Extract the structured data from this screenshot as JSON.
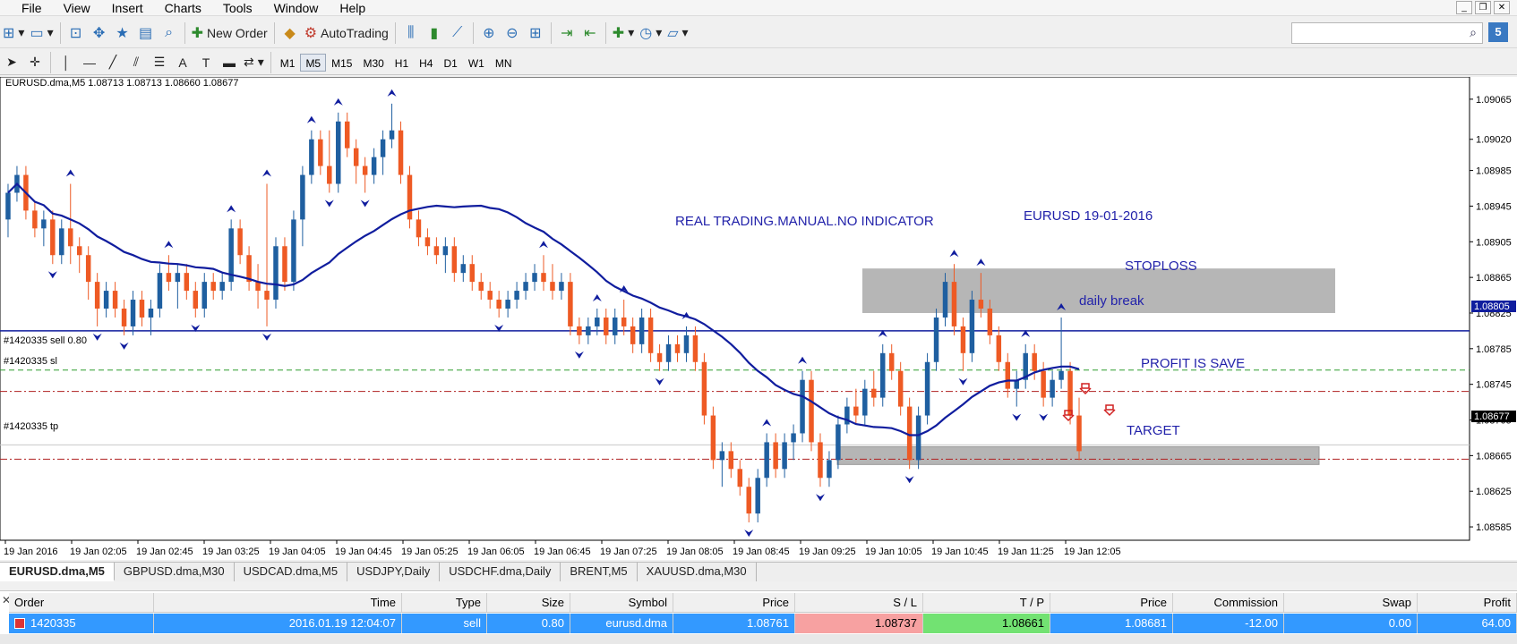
{
  "menu": [
    "File",
    "View",
    "Insert",
    "Charts",
    "Tools",
    "Window",
    "Help"
  ],
  "toolbar": {
    "new_order": "New Order",
    "autotrading": "AutoTrading",
    "timeframes": [
      "M1",
      "M5",
      "M15",
      "M30",
      "H1",
      "H4",
      "D1",
      "W1",
      "MN"
    ],
    "active_timeframe": "M5",
    "help_badge": "5"
  },
  "chart": {
    "info": "EURUSD.dma,M5  1.08713 1.08713 1.08660 1.08677",
    "title_note": "REAL TRADING.MANUAL.NO INDICATOR",
    "date_note": "EURUSD 19-01-2016",
    "stoploss_label": "STOPLOSS",
    "daily_break_label": "daily break",
    "profit_label": "PROFIT IS SAVE",
    "target_label": "TARGET",
    "order_lines": {
      "sell": "#1420335 sell 0.80",
      "sl": "#1420335 sl",
      "tp": "#1420335 tp"
    },
    "price_ticks": [
      "1.09065",
      "1.09020",
      "1.08985",
      "1.08945",
      "1.08905",
      "1.08865",
      "1.08825",
      "1.08785",
      "1.08745",
      "1.08705",
      "1.08665",
      "1.08625",
      "1.08585"
    ],
    "price_badges": {
      "daily_break": "1.08805",
      "current": "1.08677"
    },
    "time_ticks": [
      "19 Jan 2016",
      "19 Jan 02:05",
      "19 Jan 02:45",
      "19 Jan 03:25",
      "19 Jan 04:05",
      "19 Jan 04:45",
      "19 Jan 05:25",
      "19 Jan 06:05",
      "19 Jan 06:45",
      "19 Jan 07:25",
      "19 Jan 08:05",
      "19 Jan 08:45",
      "19 Jan 09:25",
      "19 Jan 10:05",
      "19 Jan 10:45",
      "19 Jan 11:25",
      "19 Jan 12:05"
    ],
    "colors": {
      "bull": "#1f5fa0",
      "bear": "#ee5a24",
      "ma": "#101d9e",
      "label": "#2222aa"
    }
  },
  "chart_data": {
    "type": "candlestick",
    "symbol": "EURUSD.dma",
    "timeframe": "M5",
    "ylim": [
      1.0857,
      1.0909
    ],
    "levels": {
      "daily_break": 1.08805,
      "sell_entry": 1.08761,
      "stop_loss": 1.08737,
      "take_profit": 1.08661,
      "current_bid": 1.08677
    },
    "zones": {
      "stoploss": [
        1.08825,
        1.08875
      ],
      "target": [
        1.08655,
        1.08675
      ]
    },
    "candles_ohlc": [
      [
        1.0893,
        1.0897,
        1.0891,
        1.0896
      ],
      [
        1.0896,
        1.0899,
        1.0895,
        1.0898
      ],
      [
        1.0898,
        1.0899,
        1.0893,
        1.0894
      ],
      [
        1.0894,
        1.0895,
        1.0891,
        1.0892
      ],
      [
        1.0892,
        1.0894,
        1.089,
        1.0893
      ],
      [
        1.0893,
        1.0894,
        1.0888,
        1.0889
      ],
      [
        1.0889,
        1.0893,
        1.0888,
        1.0892
      ],
      [
        1.0892,
        1.0897,
        1.0888,
        1.089
      ],
      [
        1.089,
        1.0891,
        1.0887,
        1.0889
      ],
      [
        1.0889,
        1.089,
        1.0884,
        1.0886
      ],
      [
        1.0886,
        1.0887,
        1.0881,
        1.0883
      ],
      [
        1.0883,
        1.0886,
        1.0882,
        1.0885
      ],
      [
        1.0885,
        1.0886,
        1.0882,
        1.0883
      ],
      [
        1.0883,
        1.0884,
        1.088,
        1.0881
      ],
      [
        1.0881,
        1.0885,
        1.088,
        1.0884
      ],
      [
        1.0884,
        1.0885,
        1.0881,
        1.0882
      ],
      [
        1.0882,
        1.0884,
        1.088,
        1.0883
      ],
      [
        1.0883,
        1.0888,
        1.0882,
        1.0887
      ],
      [
        1.0887,
        1.0889,
        1.0885,
        1.0886
      ],
      [
        1.0886,
        1.0888,
        1.0883,
        1.0887
      ],
      [
        1.0887,
        1.0888,
        1.0884,
        1.0885
      ],
      [
        1.0885,
        1.0886,
        1.0882,
        1.0883
      ],
      [
        1.0883,
        1.0887,
        1.0882,
        1.0886
      ],
      [
        1.0886,
        1.0887,
        1.0884,
        1.0885
      ],
      [
        1.0885,
        1.0887,
        1.0884,
        1.0886
      ],
      [
        1.0886,
        1.0893,
        1.0885,
        1.0892
      ],
      [
        1.0892,
        1.0893,
        1.0888,
        1.0889
      ],
      [
        1.0889,
        1.089,
        1.0885,
        1.0886
      ],
      [
        1.0886,
        1.0888,
        1.0883,
        1.0885
      ],
      [
        1.0885,
        1.0897,
        1.0881,
        1.0884
      ],
      [
        1.0884,
        1.0891,
        1.0883,
        1.089
      ],
      [
        1.089,
        1.0891,
        1.0885,
        1.0886
      ],
      [
        1.0886,
        1.0894,
        1.0885,
        1.0893
      ],
      [
        1.0893,
        1.0899,
        1.089,
        1.0898
      ],
      [
        1.0898,
        1.0903,
        1.0897,
        1.0902
      ],
      [
        1.0902,
        1.0903,
        1.0898,
        1.0899
      ],
      [
        1.0899,
        1.0903,
        1.0896,
        1.0897
      ],
      [
        1.0897,
        1.0905,
        1.0896,
        1.0904
      ],
      [
        1.0904,
        1.0905,
        1.09,
        1.0901
      ],
      [
        1.0901,
        1.0902,
        1.0897,
        1.0899
      ],
      [
        1.0899,
        1.09,
        1.0896,
        1.0898
      ],
      [
        1.0898,
        1.0901,
        1.0897,
        1.09
      ],
      [
        1.09,
        1.0903,
        1.0898,
        1.0902
      ],
      [
        1.0902,
        1.0906,
        1.0901,
        1.0903
      ],
      [
        1.0903,
        1.0904,
        1.0897,
        1.0898
      ],
      [
        1.0898,
        1.0899,
        1.0892,
        1.0893
      ],
      [
        1.0893,
        1.0894,
        1.089,
        1.0891
      ],
      [
        1.0891,
        1.0892,
        1.0889,
        1.089
      ],
      [
        1.089,
        1.0891,
        1.0888,
        1.0889
      ],
      [
        1.0889,
        1.0891,
        1.0887,
        1.089
      ],
      [
        1.089,
        1.0891,
        1.0886,
        1.0887
      ],
      [
        1.0887,
        1.0889,
        1.0886,
        1.0888
      ],
      [
        1.0888,
        1.0889,
        1.0885,
        1.0886
      ],
      [
        1.0886,
        1.0887,
        1.0884,
        1.0885
      ],
      [
        1.0885,
        1.0886,
        1.0883,
        1.0884
      ],
      [
        1.0884,
        1.0885,
        1.0882,
        1.0883
      ],
      [
        1.0883,
        1.0885,
        1.0882,
        1.0884
      ],
      [
        1.0884,
        1.0886,
        1.0883,
        1.0885
      ],
      [
        1.0885,
        1.0887,
        1.0884,
        1.0886
      ],
      [
        1.0886,
        1.0888,
        1.0885,
        1.0887
      ],
      [
        1.0887,
        1.0889,
        1.0885,
        1.0886
      ],
      [
        1.0886,
        1.0888,
        1.0884,
        1.0885
      ],
      [
        1.0885,
        1.0887,
        1.0884,
        1.0886
      ],
      [
        1.0886,
        1.0887,
        1.088,
        1.0881
      ],
      [
        1.0881,
        1.0882,
        1.0879,
        1.088
      ],
      [
        1.088,
        1.0882,
        1.0879,
        1.0881
      ],
      [
        1.0881,
        1.0883,
        1.088,
        1.0882
      ],
      [
        1.0882,
        1.0883,
        1.0879,
        1.088
      ],
      [
        1.088,
        1.0883,
        1.0879,
        1.0882
      ],
      [
        1.0882,
        1.0884,
        1.088,
        1.0881
      ],
      [
        1.0881,
        1.0882,
        1.0878,
        1.0879
      ],
      [
        1.0879,
        1.0883,
        1.0878,
        1.0882
      ],
      [
        1.0882,
        1.0883,
        1.0877,
        1.0878
      ],
      [
        1.0878,
        1.0879,
        1.0876,
        1.0877
      ],
      [
        1.0877,
        1.088,
        1.0876,
        1.0879
      ],
      [
        1.0879,
        1.088,
        1.0877,
        1.0878
      ],
      [
        1.0878,
        1.0881,
        1.0877,
        1.088
      ],
      [
        1.088,
        1.0881,
        1.0876,
        1.0877
      ],
      [
        1.0877,
        1.0878,
        1.087,
        1.0871
      ],
      [
        1.0871,
        1.0872,
        1.0865,
        1.0866
      ],
      [
        1.0866,
        1.0868,
        1.0863,
        1.0867
      ],
      [
        1.0867,
        1.0868,
        1.0864,
        1.0865
      ],
      [
        1.0865,
        1.0866,
        1.0862,
        1.0863
      ],
      [
        1.0863,
        1.0864,
        1.0859,
        1.086
      ],
      [
        1.086,
        1.0865,
        1.0859,
        1.0864
      ],
      [
        1.0864,
        1.0869,
        1.0863,
        1.0868
      ],
      [
        1.0868,
        1.0869,
        1.0864,
        1.0865
      ],
      [
        1.0865,
        1.0869,
        1.0864,
        1.0868
      ],
      [
        1.0868,
        1.087,
        1.0866,
        1.0869
      ],
      [
        1.0869,
        1.0876,
        1.0868,
        1.0875
      ],
      [
        1.0875,
        1.0876,
        1.0867,
        1.0868
      ],
      [
        1.0868,
        1.0869,
        1.0863,
        1.0864
      ],
      [
        1.0864,
        1.0867,
        1.0863,
        1.0866
      ],
      [
        1.0866,
        1.0871,
        1.0865,
        1.087
      ],
      [
        1.087,
        1.0873,
        1.0869,
        1.0872
      ],
      [
        1.0872,
        1.0874,
        1.087,
        1.0871
      ],
      [
        1.0871,
        1.0875,
        1.087,
        1.0874
      ],
      [
        1.0874,
        1.0876,
        1.0872,
        1.0873
      ],
      [
        1.0873,
        1.0879,
        1.0872,
        1.0878
      ],
      [
        1.0878,
        1.0879,
        1.0875,
        1.0876
      ],
      [
        1.0876,
        1.0877,
        1.0871,
        1.0872
      ],
      [
        1.0872,
        1.0873,
        1.0865,
        1.0866
      ],
      [
        1.0866,
        1.0872,
        1.0865,
        1.0871
      ],
      [
        1.0871,
        1.0878,
        1.087,
        1.0877
      ],
      [
        1.0877,
        1.0883,
        1.0876,
        1.0882
      ],
      [
        1.0882,
        1.0887,
        1.0881,
        1.0886
      ],
      [
        1.0886,
        1.0888,
        1.088,
        1.0881
      ],
      [
        1.0881,
        1.0882,
        1.0876,
        1.0878
      ],
      [
        1.0878,
        1.0885,
        1.0877,
        1.0884
      ],
      [
        1.0884,
        1.0887,
        1.0882,
        1.0883
      ],
      [
        1.0883,
        1.0884,
        1.0879,
        1.088
      ],
      [
        1.088,
        1.0881,
        1.0876,
        1.0877
      ],
      [
        1.0877,
        1.0878,
        1.0873,
        1.0874
      ],
      [
        1.0874,
        1.0876,
        1.0872,
        1.0875
      ],
      [
        1.0875,
        1.0879,
        1.0874,
        1.0878
      ],
      [
        1.0878,
        1.0879,
        1.0875,
        1.0876
      ],
      [
        1.0876,
        1.0877,
        1.0872,
        1.0873
      ],
      [
        1.0873,
        1.0876,
        1.0872,
        1.0875
      ],
      [
        1.0875,
        1.0882,
        1.0874,
        1.0876
      ],
      [
        1.0876,
        1.0877,
        1.087,
        1.0871
      ],
      [
        1.0871,
        1.0873,
        1.0866,
        1.0867
      ]
    ]
  },
  "tabs": [
    "EURUSD.dma,M5",
    "GBPUSD.dma,M30",
    "USDCAD.dma,M5",
    "USDJPY,Daily",
    "USDCHF.dma,Daily",
    "BRENT,M5",
    "XAUUSD.dma,M30"
  ],
  "active_tab": "EURUSD.dma,M5",
  "trade_table": {
    "headers": [
      "Order",
      "Time",
      "Type",
      "Size",
      "Symbol",
      "Price",
      "S / L",
      "T / P",
      "Price",
      "Commission",
      "Swap",
      "Profit"
    ],
    "row": {
      "order": "1420335",
      "time": "2016.01.19 12:04:07",
      "type": "sell",
      "size": "0.80",
      "symbol": "eurusd.dma",
      "price": "1.08761",
      "sl": "1.08737",
      "tp": "1.08661",
      "current_price": "1.08681",
      "commission": "-12.00",
      "swap": "0.00",
      "profit": "64.00"
    }
  }
}
